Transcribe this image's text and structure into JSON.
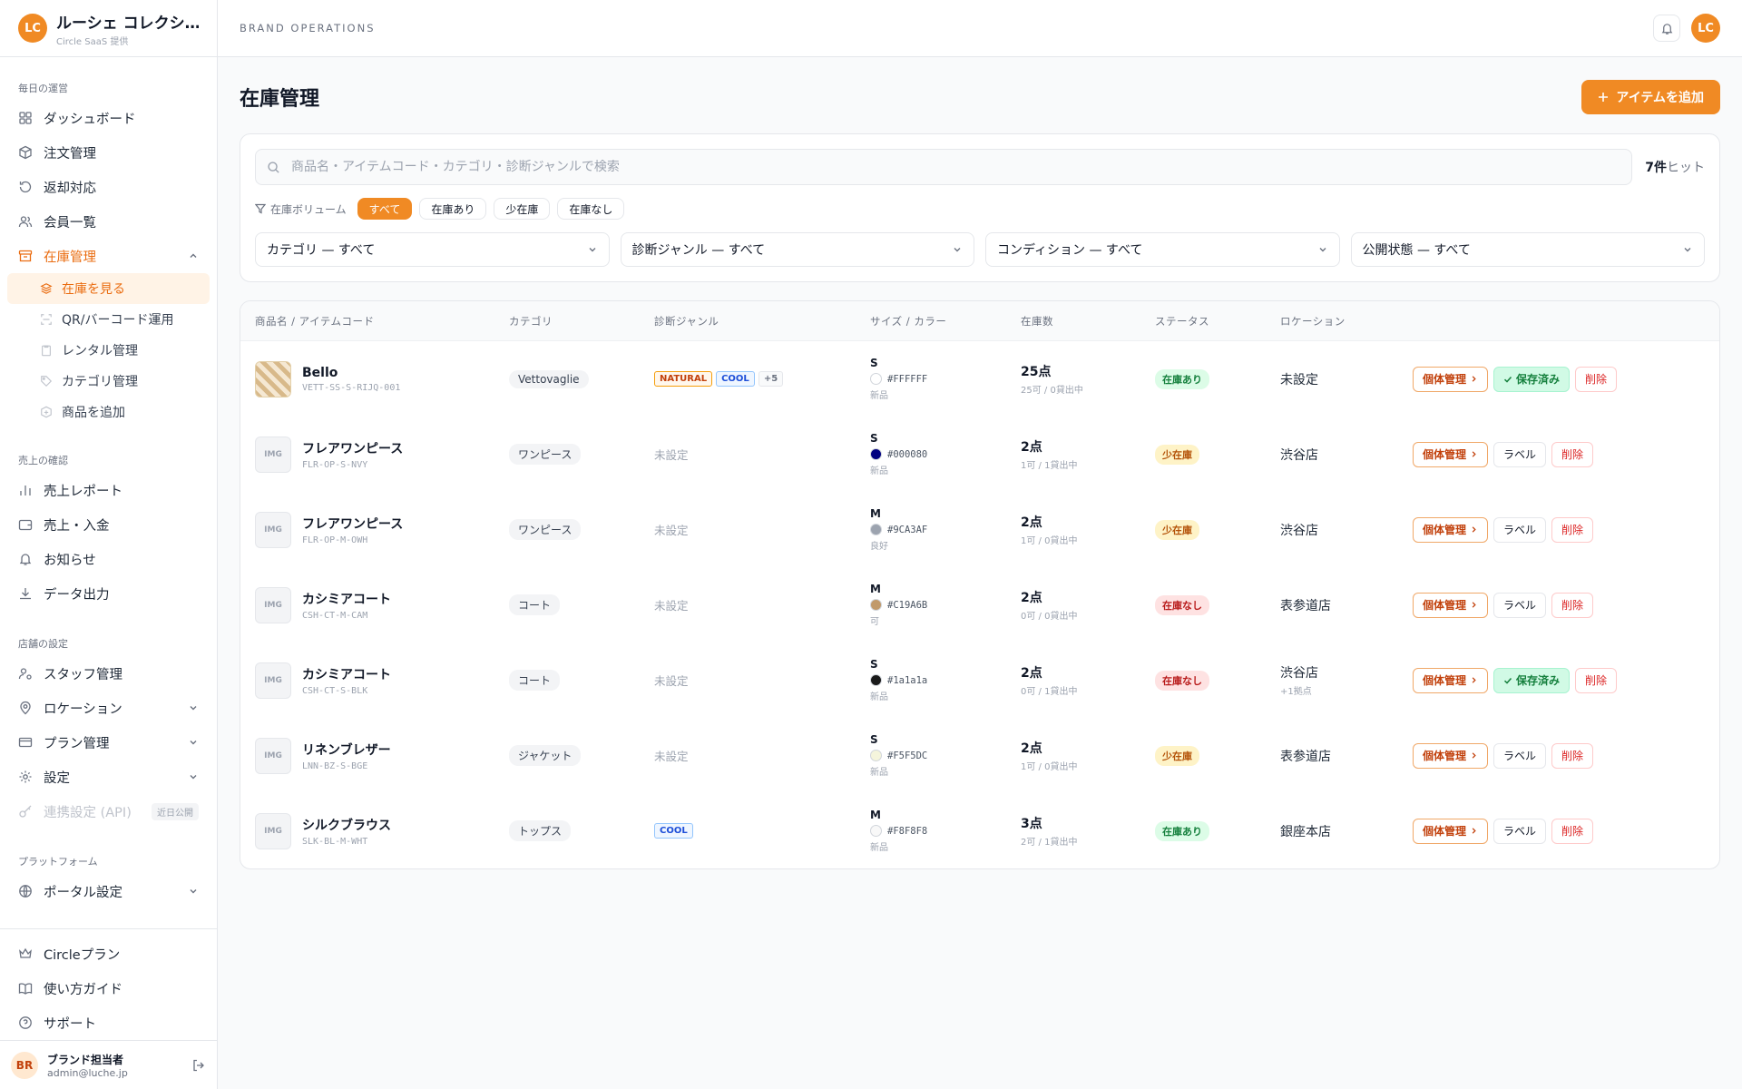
{
  "brand": {
    "initials": "LC",
    "name": "ルーシェ コレクショ...",
    "sub": "Circle SaaS 提供"
  },
  "nav": {
    "sections": [
      {
        "title": "毎日の運営"
      },
      {
        "title": "売上の確認"
      },
      {
        "title": "店舗の設定"
      },
      {
        "title": "プラットフォーム"
      }
    ],
    "daily": [
      "ダッシュボード",
      "注文管理",
      "返却対応",
      "会員一覧"
    ],
    "inventory": {
      "label": "在庫管理",
      "subs": [
        "在庫を見る",
        "QR/バーコード運用",
        "レンタル管理",
        "カテゴリ管理",
        "商品を追加"
      ]
    },
    "sales": [
      "売上レポート",
      "売上・入金",
      "お知らせ",
      "データ出力"
    ],
    "store": [
      "スタッフ管理",
      "ロケーション",
      "プラン管理",
      "設定"
    ],
    "api": {
      "label": "連携設定 (API)",
      "badge": "近日公開"
    },
    "platform": [
      "ポータル設定"
    ],
    "bottom": [
      "Circleプラン",
      "使い方ガイド",
      "サポート"
    ]
  },
  "user": {
    "initials": "BR",
    "name": "ブランド担当者",
    "email": "admin@luche.jp"
  },
  "topbar": {
    "title": "BRAND OPERATIONS",
    "avatar": "LC"
  },
  "page": {
    "title": "在庫管理",
    "add_label": "アイテムを追加"
  },
  "search": {
    "placeholder": "商品名・アイテムコード・カテゴリ・診断ジャンルで検索",
    "hit_num": "7件",
    "hit_suffix": "ヒット"
  },
  "volume": {
    "label": "在庫ボリューム",
    "chips": [
      "すべて",
      "在庫あり",
      "少在庫",
      "在庫なし"
    ],
    "active": 0
  },
  "selects": [
    "カテゴリ — すべて",
    "診断ジャンル — すべて",
    "コンディション — すべて",
    "公開状態 — すべて"
  ],
  "columns": [
    "商品名 / アイテムコード",
    "カテゴリ",
    "診断ジャンル",
    "サイズ / カラー",
    "在庫数",
    "ステータス",
    "ロケーション"
  ],
  "colors": {
    "accent": "#f08a24"
  },
  "placeholder_thumb": "IMG",
  "unset_label": "未設定",
  "actions": {
    "manage": "個体管理",
    "label": "ラベル",
    "saved": "保存済み",
    "delete": "削除"
  },
  "rows": [
    {
      "name": "Bello",
      "code": "VETT-SS-S-RIJQ-001",
      "category": "Vettovaglie",
      "genres": [
        "NATURAL",
        "COOL",
        "+5"
      ],
      "size": "S",
      "hex": "#FFFFFF",
      "swatch": "#FFFFFF",
      "condition": "新品",
      "qty": "25点",
      "qty_sub": "25可 / 0貸出中",
      "status": "在庫あり",
      "status_type": "ok",
      "location": "未設定",
      "location_sub": "",
      "saved": true,
      "pattern": true
    },
    {
      "name": "フレアワンピース",
      "code": "FLR-OP-S-NVY",
      "category": "ワンピース",
      "genres": [],
      "size": "S",
      "hex": "#000080",
      "swatch": "#000080",
      "condition": "新品",
      "qty": "2点",
      "qty_sub": "1可 / 1貸出中",
      "status": "少在庫",
      "status_type": "low",
      "location": "渋谷店",
      "location_sub": "",
      "saved": false,
      "pattern": false
    },
    {
      "name": "フレアワンピース",
      "code": "FLR-OP-M-OWH",
      "category": "ワンピース",
      "genres": [],
      "size": "M",
      "hex": "#9CA3AF",
      "swatch": "#9CA3AF",
      "condition": "良好",
      "qty": "2点",
      "qty_sub": "1可 / 0貸出中",
      "status": "少在庫",
      "status_type": "low",
      "location": "渋谷店",
      "location_sub": "",
      "saved": false,
      "pattern": false
    },
    {
      "name": "カシミアコート",
      "code": "CSH-CT-M-CAM",
      "category": "コート",
      "genres": [],
      "size": "M",
      "hex": "#C19A6B",
      "swatch": "#C19A6B",
      "condition": "可",
      "qty": "2点",
      "qty_sub": "0可 / 0貸出中",
      "status": "在庫なし",
      "status_type": "none",
      "location": "表参道店",
      "location_sub": "",
      "saved": false,
      "pattern": false
    },
    {
      "name": "カシミアコート",
      "code": "CSH-CT-S-BLK",
      "category": "コート",
      "genres": [],
      "size": "S",
      "hex": "#1a1a1a",
      "swatch": "#1a1a1a",
      "condition": "新品",
      "qty": "2点",
      "qty_sub": "0可 / 1貸出中",
      "status": "在庫なし",
      "status_type": "none",
      "location": "渋谷店",
      "location_sub": "+1拠点",
      "saved": true,
      "pattern": false
    },
    {
      "name": "リネンブレザー",
      "code": "LNN-BZ-S-BGE",
      "category": "ジャケット",
      "genres": [],
      "size": "S",
      "hex": "#F5F5DC",
      "swatch": "#F5F5DC",
      "condition": "新品",
      "qty": "2点",
      "qty_sub": "1可 / 0貸出中",
      "status": "少在庫",
      "status_type": "low",
      "location": "表参道店",
      "location_sub": "",
      "saved": false,
      "pattern": false
    },
    {
      "name": "シルクブラウス",
      "code": "SLK-BL-M-WHT",
      "category": "トップス",
      "genres": [
        "COOL"
      ],
      "size": "M",
      "hex": "#F8F8F8",
      "swatch": "#F8F8F8",
      "condition": "新品",
      "qty": "3点",
      "qty_sub": "2可 / 1貸出中",
      "status": "在庫あり",
      "status_type": "ok",
      "location": "銀座本店",
      "location_sub": "",
      "saved": false,
      "pattern": false
    }
  ]
}
